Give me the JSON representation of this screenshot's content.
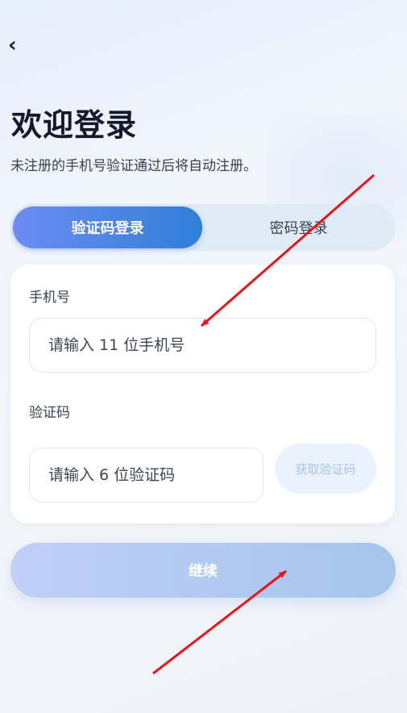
{
  "nav": {
    "back_icon": "‹"
  },
  "header": {
    "title": "欢迎登录",
    "subtitle": "未注册的手机号验证通过后将自动注册。"
  },
  "tabs": [
    {
      "label": "验证码登录",
      "active": true
    },
    {
      "label": "密码登录",
      "active": false
    }
  ],
  "form": {
    "phone_label": "手机号",
    "phone_placeholder": "请输入 11 位手机号",
    "phone_value": "",
    "code_label": "验证码",
    "code_placeholder": "请输入 6 位验证码",
    "code_value": "",
    "get_code_label": "获取验证码"
  },
  "actions": {
    "continue_label": "继续"
  },
  "colors": {
    "accent_start": "#6e8bf2",
    "accent_end": "#2f7fd8",
    "annotation_arrow": "#e8151b"
  }
}
